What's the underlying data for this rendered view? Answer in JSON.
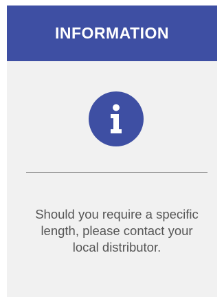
{
  "card": {
    "title": "INFORMATION",
    "icon": "info-icon",
    "message": "Should you require a specific length, please contact your local distributor."
  },
  "colors": {
    "accent": "#3e4fa3",
    "card_background": "#f1f1f1",
    "text": "#555555",
    "divider": "#6d6d6d"
  }
}
